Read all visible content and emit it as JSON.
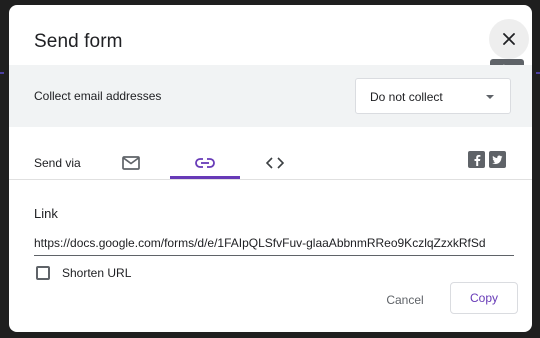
{
  "dialog": {
    "title": "Send form",
    "close_tooltip": "Close",
    "collect_email_label": "Collect email addresses",
    "collect_email_selected": "Do not collect",
    "send_via_label": "Send via",
    "tabs": [
      {
        "icon": "email-icon",
        "active": false
      },
      {
        "icon": "link-icon",
        "active": true
      },
      {
        "icon": "embed-code-icon",
        "active": false
      }
    ],
    "social": [
      {
        "icon": "facebook-icon"
      },
      {
        "icon": "twitter-icon"
      }
    ],
    "link_heading": "Link",
    "link_url": "https://docs.google.com/forms/d/e/1FAIpQLSfvFuv-glaaAbbnmRReo9KczlqZzxkRfSd",
    "shorten_url_label": "Shorten URL",
    "shorten_url_checked": false,
    "cancel_label": "Cancel",
    "copy_label": "Copy"
  },
  "colors": {
    "accent": "#673ab7",
    "band_bg": "#f1f3f4",
    "backdrop": "#1f1f1f",
    "tooltip_bg": "#5f6368"
  }
}
